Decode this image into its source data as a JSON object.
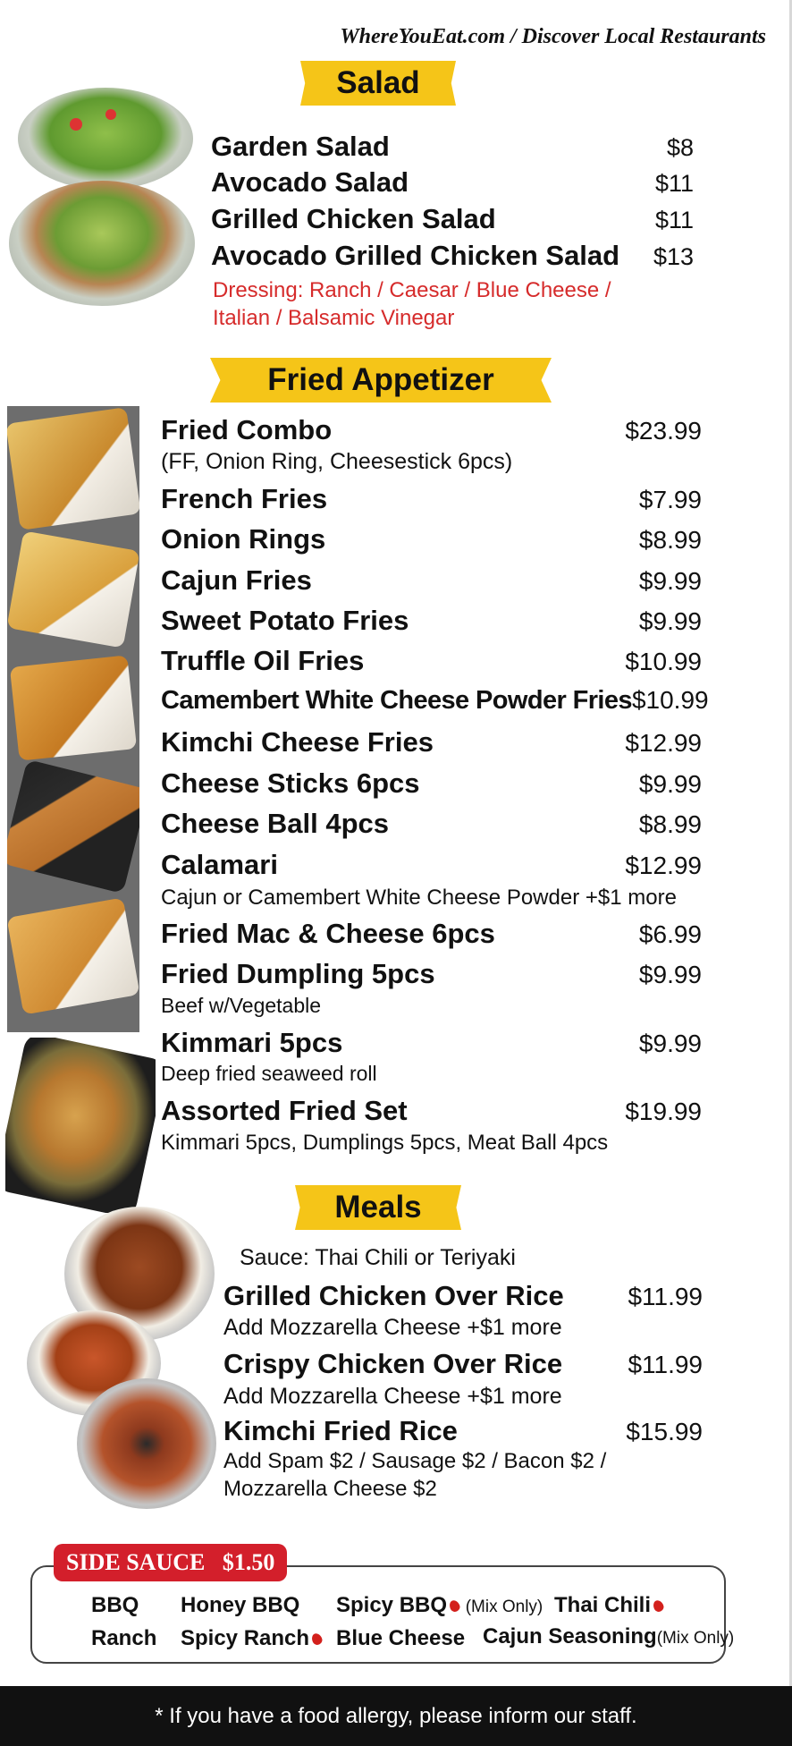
{
  "header": {
    "site": "WhereYouEat.com / Discover Local Restaurants"
  },
  "salad": {
    "title": "Salad",
    "items": [
      {
        "name": "Garden Salad",
        "price": "$8"
      },
      {
        "name": "Avocado Salad",
        "price": "$11"
      },
      {
        "name": "Grilled Chicken Salad",
        "price": "$11"
      },
      {
        "name": "Avocado Grilled Chicken Salad",
        "price": "$13"
      }
    ],
    "dressing_line1": "Dressing: Ranch / Caesar / Blue Cheese /",
    "dressing_line2": "Italian / Balsamic Vinegar"
  },
  "fried": {
    "title": "Fried Appetizer",
    "items": [
      {
        "name": "Fried Combo",
        "price": "$23.99",
        "note": "(FF, Onion Ring, Cheesestick 6pcs)"
      },
      {
        "name": "French Fries",
        "price": "$7.99"
      },
      {
        "name": "Onion Rings",
        "price": "$8.99"
      },
      {
        "name": "Cajun Fries",
        "price": "$9.99"
      },
      {
        "name": "Sweet Potato Fries",
        "price": "$9.99"
      },
      {
        "name": "Truffle Oil Fries",
        "price": "$10.99"
      },
      {
        "name": "Camembert White Cheese Powder Fries",
        "price": "$10.99"
      },
      {
        "name": "Kimchi Cheese Fries",
        "price": "$12.99"
      },
      {
        "name": "Cheese Sticks 6pcs",
        "price": "$9.99"
      },
      {
        "name": "Cheese Ball 4pcs",
        "price": "$8.99"
      },
      {
        "name": "Calamari",
        "price": "$12.99",
        "note": "Cajun or Camembert White Cheese Powder +$1 more"
      },
      {
        "name": "Fried Mac & Cheese 6pcs",
        "price": "$6.99"
      },
      {
        "name": "Fried Dumpling 5pcs",
        "price": "$9.99",
        "note": "Beef w/Vegetable"
      },
      {
        "name": "Kimmari 5pcs",
        "price": "$9.99",
        "note": "Deep fried seaweed roll"
      },
      {
        "name": "Assorted Fried Set",
        "price": "$19.99",
        "note": "Kimmari 5pcs, Dumplings 5pcs, Meat Ball 4pcs"
      }
    ]
  },
  "meals": {
    "title": "Meals",
    "sauce_note": "Sauce: Thai Chili or Teriyaki",
    "items": [
      {
        "name": "Grilled Chicken Over Rice",
        "price": "$11.99",
        "note": "Add  Mozzarella Cheese +$1 more"
      },
      {
        "name": "Crispy Chicken Over Rice",
        "price": "$11.99",
        "note": "Add  Mozzarella Cheese +$1 more"
      },
      {
        "name": "Kimchi Fried Rice",
        "price": "$15.99",
        "note": "Add Spam $2 / Sausage $2 / Bacon $2 /",
        "note2": "Mozzarella Cheese $2"
      }
    ]
  },
  "side_sauce": {
    "label": "SIDE SAUCE   $1.50",
    "items": [
      "BBQ",
      "Honey BBQ",
      "Spicy BBQ",
      "Thai Chili",
      "Ranch",
      "Spicy Ranch",
      "Blue Cheese",
      "Cajun Seasoning"
    ],
    "mix_only": "(Mix Only)"
  },
  "footer": {
    "text": "* If you have a food allergy, please inform our staff."
  },
  "colors": {
    "banner": "#f5c518",
    "dressing": "#d62b2b",
    "sauce_tag": "#d31f2b",
    "footer_bg": "#111111"
  }
}
